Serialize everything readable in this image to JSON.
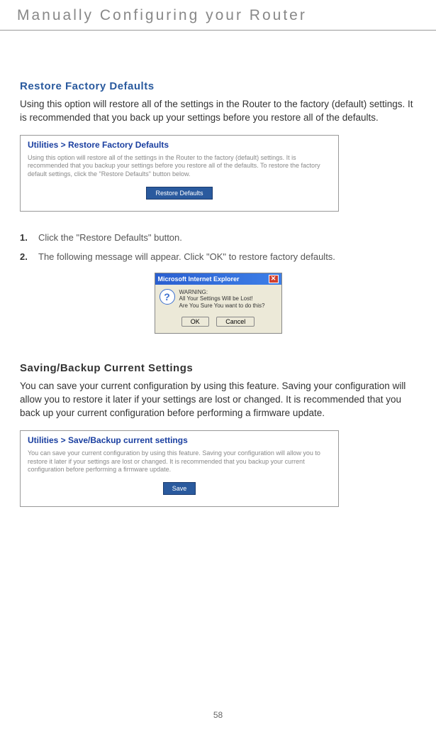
{
  "header": {
    "title": "Manually Configuring your Router"
  },
  "section1": {
    "title": "Restore Factory Defaults",
    "intro": "Using this option will restore all of the settings in the Router to the factory (default) settings. It is recommended that you back up your settings before you restore all of the defaults."
  },
  "panel1": {
    "title": "Utilities > Restore Factory Defaults",
    "desc": "Using this option will restore all of the settings in the Router to the factory (default) settings. It is recommended that you backup your settings before you restore all of the defaults. To restore the factory default settings, click the \"Restore Defaults\" button below.",
    "button": "Restore Defaults"
  },
  "steps": [
    {
      "num": "1.",
      "text": "Click the \"Restore Defaults\" button."
    },
    {
      "num": "2.",
      "text": "The following message will appear. Click \"OK\" to restore factory defaults."
    }
  ],
  "dialog": {
    "title": "Microsoft Internet Explorer",
    "line1": "WARNING:",
    "line2": "All Your Settings Will be Lost!",
    "line3": "Are You Sure You want to do this?",
    "ok": "OK",
    "cancel": "Cancel"
  },
  "section2": {
    "title": "Saving/Backup Current Settings",
    "intro": "You can save your current configuration by using this feature. Saving your configuration will allow you to restore it later if your settings are lost or changed. It is recommended that you back up your current configuration before performing a firmware update."
  },
  "panel2": {
    "title": "Utilities > Save/Backup current settings",
    "desc": "You can save your current configuration by using this feature. Saving your configuration will allow you to restore it later if your settings are lost or changed. It is recommended that you backup your current configuration before performing a firmware update.",
    "button": "Save"
  },
  "pageNumber": "58"
}
